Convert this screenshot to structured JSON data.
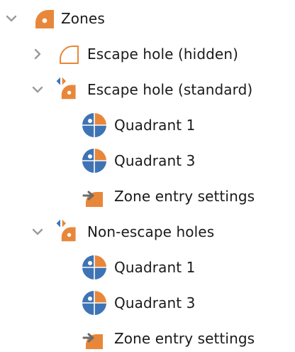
{
  "tree": {
    "root": {
      "label": "Zones",
      "icon": "zone-quarter-icon",
      "expanded": true,
      "children": [
        {
          "label": "Escape hole (hidden)",
          "icon": "zone-outline-icon",
          "expanded": false
        },
        {
          "label": "Escape hole (standard)",
          "icon": "zone-transition-icon",
          "expanded": true,
          "children": [
            {
              "label": "Quadrant 1",
              "icon": "quadrant-icon"
            },
            {
              "label": "Quadrant 3",
              "icon": "quadrant-icon"
            },
            {
              "label": "Zone entry settings",
              "icon": "zone-entry-icon"
            }
          ]
        },
        {
          "label": "Non-escape holes",
          "icon": "zone-transition-icon",
          "expanded": true,
          "children": [
            {
              "label": "Quadrant 1",
              "icon": "quadrant-icon"
            },
            {
              "label": "Quadrant 3",
              "icon": "quadrant-icon"
            },
            {
              "label": "Zone entry settings",
              "icon": "zone-entry-icon"
            }
          ]
        }
      ]
    }
  },
  "colors": {
    "orange": "#E8873A",
    "blue": "#3E74B5",
    "chevron": "#9a9a9a",
    "text": "#1a1a1a"
  }
}
